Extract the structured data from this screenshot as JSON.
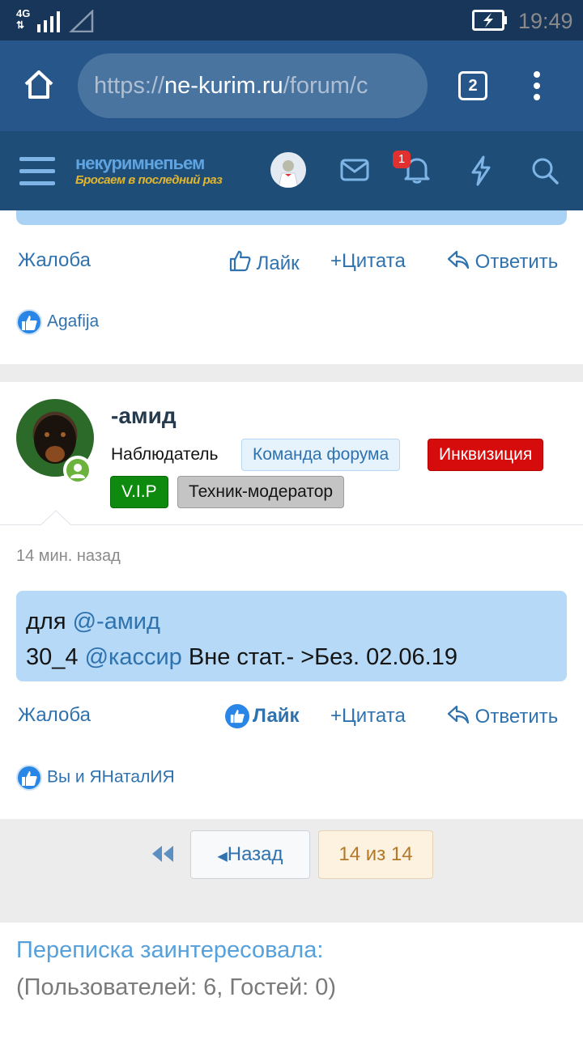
{
  "status_bar": {
    "network": "4G",
    "time": "19:49"
  },
  "browser": {
    "url_scheme": "https://",
    "url_host": "ne-kurim.ru",
    "url_path": "/forum/c",
    "tab_count": "2"
  },
  "forum_nav": {
    "logo_title": "некуримнепьем",
    "logo_tagline": "Бросаем в последний раз",
    "notification_count": "1"
  },
  "prev_post": {
    "report": "Жалоба",
    "like": "Лайк",
    "quote": "Цитата",
    "reply": "Ответить",
    "likers": "Agafija"
  },
  "post": {
    "author": "-амид",
    "role": "Наблюдатель",
    "tags": [
      {
        "label": "Команда форума",
        "bg": "#e6f2fc",
        "fg": "#2f72ae",
        "border": "#b5d6f2"
      },
      {
        "label": "Инквизиция",
        "bg": "#d60c0c",
        "fg": "#ffffff",
        "border": "#b30000"
      },
      {
        "label": "V.I.P",
        "bg": "#0e8a0e",
        "fg": "#ffffff",
        "border": "#086b08"
      },
      {
        "label": "Техник-модератор",
        "bg": "#c4c4c4",
        "fg": "#141414",
        "border": "#9c9c9c"
      }
    ],
    "time": "14 мин. назад",
    "line1_prefix": "для ",
    "line1_mention": "@-амид",
    "line2_prefix": "30_4 ",
    "line2_mention": "@кассир",
    "line2_suffix": " Вне стат.- >Без. 02.06.19",
    "report": "Жалоба",
    "like": "Лайк",
    "quote": "Цитата",
    "reply": "Ответить",
    "likers": "Вы и ЯНаталИЯ"
  },
  "pagination": {
    "back": "Назад",
    "position": "14 из 14"
  },
  "online": {
    "title": "Переписка заинтересовала:",
    "subtitle": "(Пользователей: 6, Гостей: 0)"
  }
}
